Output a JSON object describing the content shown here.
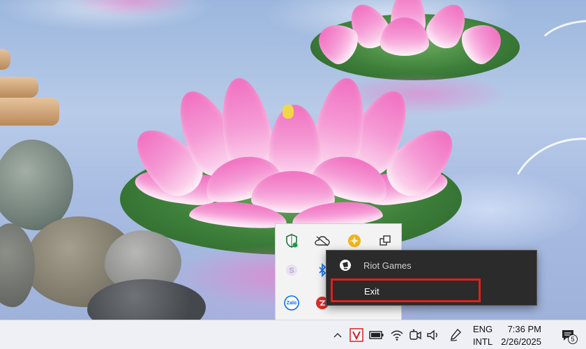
{
  "context_menu": {
    "app_name": "Riot Games",
    "exit_label": "Exit"
  },
  "tray_flyout": {
    "icons": [
      "windows-security-icon",
      "onedrive-icon",
      "app-yellow-icon",
      "task-view-icon",
      "skype-icon",
      "bluetooth-icon",
      "zalo-icon",
      "red-app-icon"
    ],
    "zalo_label": "Zalo"
  },
  "taskbar": {
    "language_top": "ENG",
    "language_bottom": "INTL",
    "time": "7:36 PM",
    "date": "2/26/2025",
    "notification_count": "5"
  },
  "colors": {
    "highlight_border": "#e0201c",
    "menu_background": "#2b2b2b",
    "taskbar_background": "#eef0f5"
  }
}
